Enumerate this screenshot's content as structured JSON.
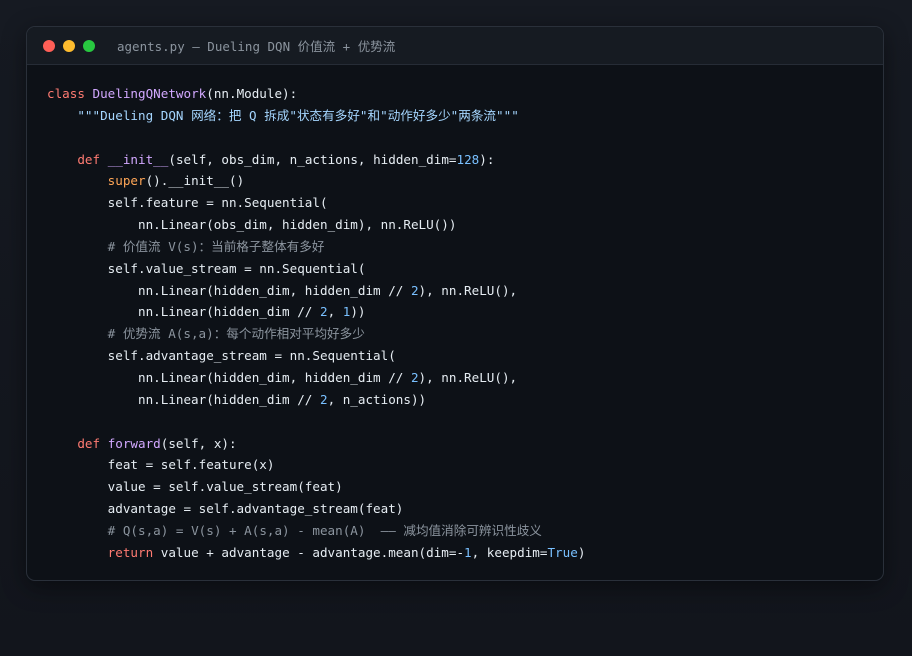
{
  "window": {
    "title": "agents.py — Dueling DQN 价值流 + 优势流",
    "controls": [
      "close",
      "minimize",
      "maximize"
    ],
    "colors": {
      "close": "#ff5f57",
      "minimize": "#febc2e",
      "maximize": "#28c840"
    }
  },
  "code": {
    "language": "python",
    "lines": [
      [
        [
          "kw",
          "class "
        ],
        [
          "fn",
          "DuelingQNetwork"
        ],
        [
          "p",
          "(nn.Module):"
        ]
      ],
      [
        [
          "p",
          "    "
        ],
        [
          "str",
          "\"\"\"Dueling DQN 网络：把 Q 拆成\"状态有多好\"和\"动作好多少\"两条流\"\"\""
        ]
      ],
      [],
      [
        [
          "p",
          "    "
        ],
        [
          "kw",
          "def "
        ],
        [
          "fn",
          "__init__"
        ],
        [
          "p",
          "(self, obs_dim, n_actions, hidden_dim="
        ],
        [
          "num",
          "128"
        ],
        [
          "p",
          "):"
        ]
      ],
      [
        [
          "p",
          "        "
        ],
        [
          "bi",
          "super"
        ],
        [
          "p",
          "().__init__()"
        ]
      ],
      [
        [
          "p",
          "        self.feature = nn.Sequential("
        ]
      ],
      [
        [
          "p",
          "            nn.Linear(obs_dim, hidden_dim), nn.ReLU())"
        ]
      ],
      [
        [
          "p",
          "        "
        ],
        [
          "cm",
          "# 价值流 V(s)：当前格子整体有多好"
        ]
      ],
      [
        [
          "p",
          "        self.value_stream = nn.Sequential("
        ]
      ],
      [
        [
          "p",
          "            nn.Linear(hidden_dim, hidden_dim // "
        ],
        [
          "num",
          "2"
        ],
        [
          "p",
          "), nn.ReLU(),"
        ]
      ],
      [
        [
          "p",
          "            nn.Linear(hidden_dim // "
        ],
        [
          "num",
          "2"
        ],
        [
          "p",
          ", "
        ],
        [
          "num",
          "1"
        ],
        [
          "p",
          "))"
        ]
      ],
      [
        [
          "p",
          "        "
        ],
        [
          "cm",
          "# 优势流 A(s,a)：每个动作相对平均好多少"
        ]
      ],
      [
        [
          "p",
          "        self.advantage_stream = nn.Sequential("
        ]
      ],
      [
        [
          "p",
          "            nn.Linear(hidden_dim, hidden_dim // "
        ],
        [
          "num",
          "2"
        ],
        [
          "p",
          "), nn.ReLU(),"
        ]
      ],
      [
        [
          "p",
          "            nn.Linear(hidden_dim // "
        ],
        [
          "num",
          "2"
        ],
        [
          "p",
          ", n_actions))"
        ]
      ],
      [],
      [
        [
          "p",
          "    "
        ],
        [
          "kw",
          "def "
        ],
        [
          "fn",
          "forward"
        ],
        [
          "p",
          "(self, x):"
        ]
      ],
      [
        [
          "p",
          "        feat = self.feature(x)"
        ]
      ],
      [
        [
          "p",
          "        value = self.value_stream(feat)"
        ]
      ],
      [
        [
          "p",
          "        advantage = self.advantage_stream(feat)"
        ]
      ],
      [
        [
          "p",
          "        "
        ],
        [
          "cm",
          "# Q(s,a) = V(s) + A(s,a) - mean(A)  —— 减均值消除可辨识性歧义"
        ]
      ],
      [
        [
          "p",
          "        "
        ],
        [
          "kw",
          "return "
        ],
        [
          "p",
          "value + advantage - advantage.mean(dim=-"
        ],
        [
          "num",
          "1"
        ],
        [
          "p",
          ", keepdim="
        ],
        [
          "bool",
          "True"
        ],
        [
          "p",
          ")"
        ]
      ]
    ]
  }
}
